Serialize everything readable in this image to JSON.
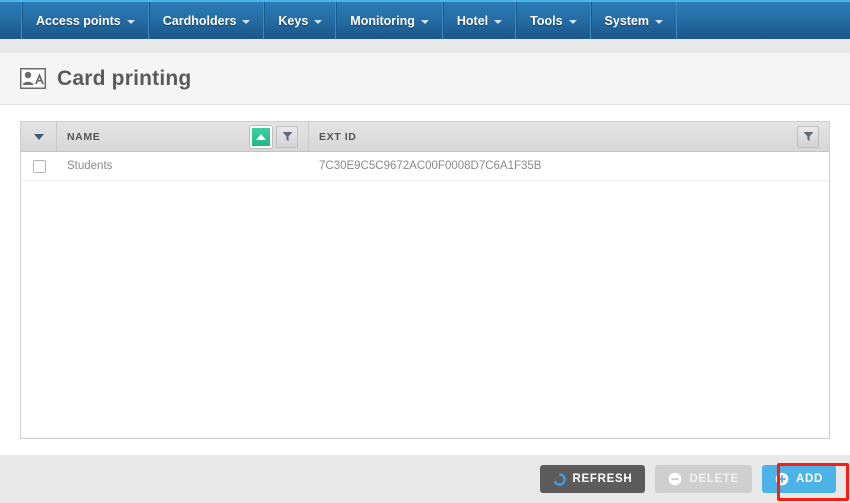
{
  "nav": {
    "items": [
      {
        "label": "Access points",
        "icon": "chevron-down-icon"
      },
      {
        "label": "Cardholders",
        "icon": "chevron-down-icon"
      },
      {
        "label": "Keys",
        "icon": "chevron-down-icon"
      },
      {
        "label": "Monitoring",
        "icon": "chevron-down-icon"
      },
      {
        "label": "Hotel",
        "icon": "chevron-down-icon"
      },
      {
        "label": "Tools",
        "icon": "chevron-down-icon"
      },
      {
        "label": "System",
        "icon": "chevron-down-icon"
      }
    ]
  },
  "header": {
    "title": "Card printing",
    "icon": "id-card-person-icon"
  },
  "table": {
    "select_all_icon": "chevron-down-icon",
    "columns": [
      {
        "label": "NAME",
        "sort_icon": "sort-ascending-icon",
        "filter_icon": "filter-funnel-icon",
        "sorted": "asc"
      },
      {
        "label": "EXT ID",
        "filter_icon": "filter-funnel-icon",
        "sorted": "none"
      }
    ],
    "rows": [
      {
        "selected": false,
        "name": "Students",
        "ext_id": "7C30E9C5C9672AC00F0008D7C6A1F35B"
      }
    ]
  },
  "footer": {
    "buttons": [
      {
        "label": "REFRESH",
        "icon": "refresh-circular-arrow-icon",
        "state": "enabled",
        "color": "#5c5c5c"
      },
      {
        "label": "DELETE",
        "icon": "minus-circle-icon",
        "state": "disabled",
        "color": "#cfcfcf"
      },
      {
        "label": "ADD",
        "icon": "plus-circle-icon",
        "state": "enabled",
        "color": "#4bb3e6"
      }
    ]
  },
  "annotation": {
    "highlight_color": "#ff1a14",
    "target": "ADD"
  }
}
